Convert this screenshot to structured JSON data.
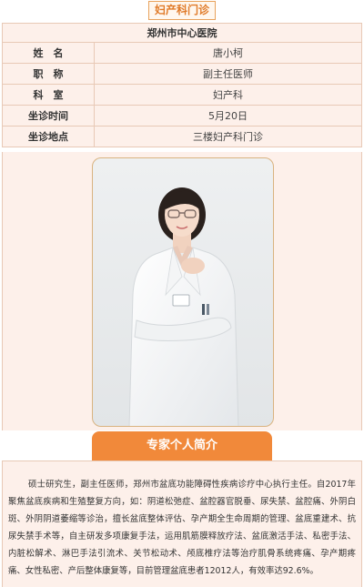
{
  "header": {
    "tab_label": "妇产科门诊"
  },
  "info_table": {
    "hospital": "郑州市中心医院",
    "rows": [
      {
        "label": "姓　名",
        "value": "唐小柯"
      },
      {
        "label": "职　称",
        "value": "副主任医师"
      },
      {
        "label": "科　室",
        "value": "妇产科"
      },
      {
        "label": "坐诊时间",
        "value": "5月20日"
      },
      {
        "label": "坐诊地点",
        "value": "三楼妇产科门诊"
      }
    ]
  },
  "intro": {
    "section_title": "专家个人简介",
    "bio": "硕士研究生，副主任医师，郑州市盆底功能障碍性疾病诊疗中心执行主任。自2017年聚焦盆底疾病和生殖整复方向，如：阴道松弛症、盆腔器官脱垂、尿失禁、盆腔痛、外阴白斑、外阴阴道萎缩等诊治，擅长盆底整体评估、孕产期全生命周期的管理、盆底重建术、抗尿失禁手术等，自主研发多项康复手法，运用肌筋膜释放疗法、盆底激活手法、私密手法、内脏松解术、淋巴手法引流术、关节松动术、颅底椎疗法等治疗肌骨系统疼痛、孕产期疼痛、女性私密、产后整体康复等，目前管理盆底患者12012人，有效率达92.6%。"
  },
  "colors": {
    "accent": "#f1893a",
    "tab_text": "#e07a28",
    "panel_bg": "#fdf0ea",
    "border": "#e8c9b6"
  }
}
